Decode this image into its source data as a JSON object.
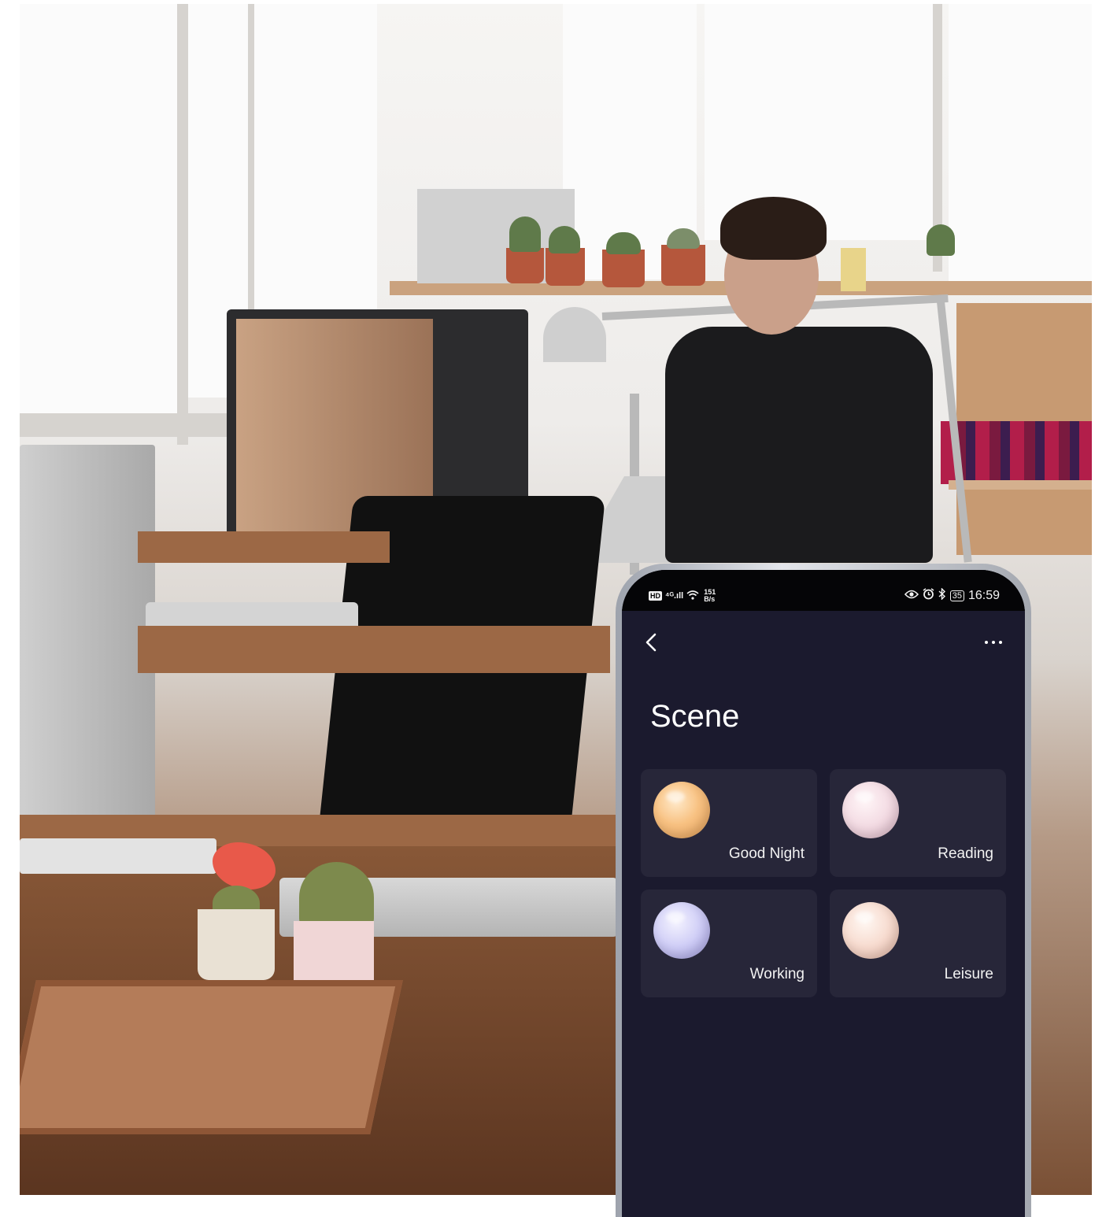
{
  "statusbar": {
    "left_badge": "HD",
    "network": "⁴ᴳ.ıll",
    "speed_value": "151",
    "speed_unit": "B/s",
    "battery": "35",
    "time": "16:59"
  },
  "header": {
    "back_icon": "chevron-left-icon",
    "more_icon": "more-horizontal-icon"
  },
  "page": {
    "title": "Scene"
  },
  "scenes": [
    {
      "label": "Good Night",
      "color": "#f5b469"
    },
    {
      "label": "Reading",
      "color": "#f2d3df"
    },
    {
      "label": "Working",
      "color": "#c3c0f2"
    },
    {
      "label": "Leisure",
      "color": "#f6d2c4"
    }
  ],
  "colors": {
    "screen_background": "#1b1a2e",
    "card_background": "#272639",
    "text": "#ffffff"
  }
}
